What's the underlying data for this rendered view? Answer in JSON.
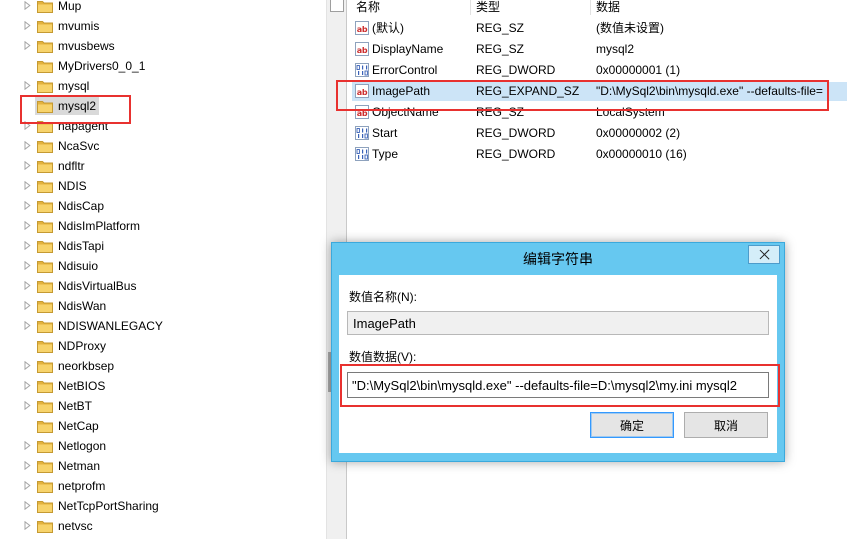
{
  "tree": {
    "expand_icon": "expand-arrow-icon",
    "folder_icon": "folder-icon",
    "items": [
      {
        "label": "Mup",
        "expandable": true
      },
      {
        "label": "mvumis",
        "expandable": true
      },
      {
        "label": "mvusbews",
        "expandable": true
      },
      {
        "label": "MyDrivers0_0_1",
        "expandable": false
      },
      {
        "label": "mysql",
        "expandable": true
      },
      {
        "label": "mysql2",
        "expandable": false,
        "selected": true
      },
      {
        "label": "napagent",
        "expandable": true
      },
      {
        "label": "NcaSvc",
        "expandable": true
      },
      {
        "label": "ndfltr",
        "expandable": true
      },
      {
        "label": "NDIS",
        "expandable": true
      },
      {
        "label": "NdisCap",
        "expandable": true
      },
      {
        "label": "NdisImPlatform",
        "expandable": true
      },
      {
        "label": "NdisTapi",
        "expandable": true
      },
      {
        "label": "Ndisuio",
        "expandable": true
      },
      {
        "label": "NdisVirtualBus",
        "expandable": true
      },
      {
        "label": "NdisWan",
        "expandable": true
      },
      {
        "label": "NDISWANLEGACY",
        "expandable": true
      },
      {
        "label": "NDProxy",
        "expandable": false
      },
      {
        "label": "neorkbsep",
        "expandable": true
      },
      {
        "label": "NetBIOS",
        "expandable": true
      },
      {
        "label": "NetBT",
        "expandable": true
      },
      {
        "label": "NetCap",
        "expandable": false
      },
      {
        "label": "Netlogon",
        "expandable": true
      },
      {
        "label": "Netman",
        "expandable": true
      },
      {
        "label": "netprofm",
        "expandable": true
      },
      {
        "label": "NetTcpPortSharing",
        "expandable": true
      },
      {
        "label": "netvsc",
        "expandable": true
      }
    ]
  },
  "icon_glyphs": {
    "string": "ab"
  },
  "values": {
    "columns": {
      "name": "名称",
      "type": "类型",
      "data": "数据"
    },
    "rows": [
      {
        "icon": "string-value-icon",
        "name": "(默认)",
        "type": "REG_SZ",
        "data": "(数值未设置)"
      },
      {
        "icon": "string-value-icon",
        "name": "DisplayName",
        "type": "REG_SZ",
        "data": "mysql2"
      },
      {
        "icon": "dword-value-icon",
        "name": "ErrorControl",
        "type": "REG_DWORD",
        "data": "0x00000001 (1)"
      },
      {
        "icon": "string-value-icon",
        "name": "ImagePath",
        "type": "REG_EXPAND_SZ",
        "data": "\"D:\\MySql2\\bin\\mysqld.exe\" --defaults-file=",
        "selected": true
      },
      {
        "icon": "string-value-icon",
        "name": "ObjectName",
        "type": "REG_SZ",
        "data": "LocalSystem"
      },
      {
        "icon": "dword-value-icon",
        "name": "Start",
        "type": "REG_DWORD",
        "data": "0x00000002 (2)"
      },
      {
        "icon": "dword-value-icon",
        "name": "Type",
        "type": "REG_DWORD",
        "data": "0x00000010 (16)"
      }
    ]
  },
  "dialog": {
    "title": "编辑字符串",
    "value_name_label": "数值名称(N):",
    "value_name": "ImagePath",
    "value_data_label": "数值数据(V):",
    "value_data": "\"D:\\MySql2\\bin\\mysqld.exe\" --defaults-file=D:\\mysql2\\my.ini mysql2",
    "ok_label": "确定",
    "cancel_label": "取消",
    "close_icon": "close-icon"
  },
  "colors": {
    "title_bar": "#66c8f0",
    "title_bar_border": "#3ba9dc",
    "tree_selection": "#d9d9d9",
    "row_selection": "#cce4f7",
    "annotation_red": "#e8312f",
    "default_button_border": "#3399ff",
    "folder": "#f7d36b",
    "folder_dark": "#e4b33f",
    "folder_edge": "#c59a32",
    "dword_icon": "#3a62b8"
  }
}
